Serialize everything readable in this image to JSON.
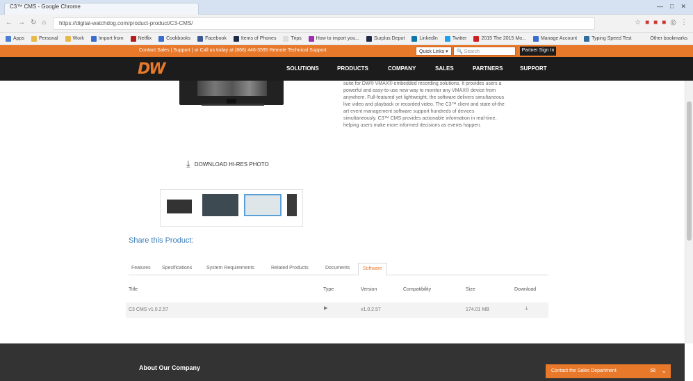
{
  "browser": {
    "tab_title": "C3™ CMS - Google Chrome",
    "url": "https://digital-watchdog.com/product-product/C3-CMS/",
    "window_controls": [
      "—",
      "□",
      "✕"
    ],
    "bookmarks": [
      {
        "label": "Apps",
        "color": "#4a7fd4"
      },
      {
        "label": "Personal",
        "color": "#e8b84a"
      },
      {
        "label": "Work",
        "color": "#e8b84a"
      },
      {
        "label": "Import from",
        "color": "#3b6cd0"
      },
      {
        "label": "Netflix",
        "color": "#b31d1d"
      },
      {
        "label": "Cookbooks",
        "color": "#3b6cd0"
      },
      {
        "label": "Facebook",
        "color": "#3b5998"
      },
      {
        "label": "Items of Phones",
        "color": "#1f2a44"
      },
      {
        "label": "Trips",
        "color": "#dddddd"
      },
      {
        "label": "How to import you...",
        "color": "#9c2fae"
      },
      {
        "label": "Surplus Depot",
        "color": "#1f2a44"
      },
      {
        "label": "LinkedIn",
        "color": "#0e76a8"
      },
      {
        "label": "Twitter",
        "color": "#1da1f2"
      },
      {
        "label": "2015 The 2015 Mo...",
        "color": "#cc1f1f"
      },
      {
        "label": "Manage Account",
        "color": "#3b6cd0"
      },
      {
        "label": "Typing Speed Test",
        "color": "#2f6d9e"
      }
    ],
    "other_bookmarks": "Other bookmarks"
  },
  "site": {
    "contact_line": "Contact Sales | Support | or Call us today at (866) 446-3595  Remote Technical Support",
    "quick_links": "Quick Links ▾",
    "search_placeholder": "Search",
    "partner_sign_in": "Partner Sign In",
    "logo": "DW",
    "nav": [
      "SOLUTIONS",
      "PRODUCTS",
      "COMPANY",
      "SALES",
      "PARTNERS",
      "SUPPORT"
    ]
  },
  "product": {
    "description": [
      "suite for DW® VMAX® embedded recording solutions. It provides users a",
      "powerful and easy-to-use new way to monitor any VMAX® device from",
      "anywhere. Full-featured yet lightweight, the software delivers simultaneous",
      "live video and playback or recorded video. The C3™ client and state-of-the",
      "art event management software support hundreds of devices",
      "simultaneously. C3™ CMS provides actionable information in real-time,",
      "helping users make more informed decisions as events happen."
    ],
    "download_photo": "DOWNLOAD HI-RES PHOTO",
    "share_title": "Share this Product:",
    "tabs": [
      "Features",
      "Specifications",
      "System Requirements",
      "Related Products",
      "Documents",
      "Software"
    ],
    "table": {
      "headers": [
        "Title",
        "Type",
        "Version",
        "Compatibility",
        "Size",
        "Download"
      ],
      "rows": [
        {
          "title": "C3 CMS v1.0.2.57",
          "version": "v1.0.2.57",
          "compatibility": "",
          "size": "174.01 MB"
        }
      ]
    }
  },
  "footer": {
    "about": "About Our Company",
    "contact_sales": "Contact the Sales Department"
  }
}
